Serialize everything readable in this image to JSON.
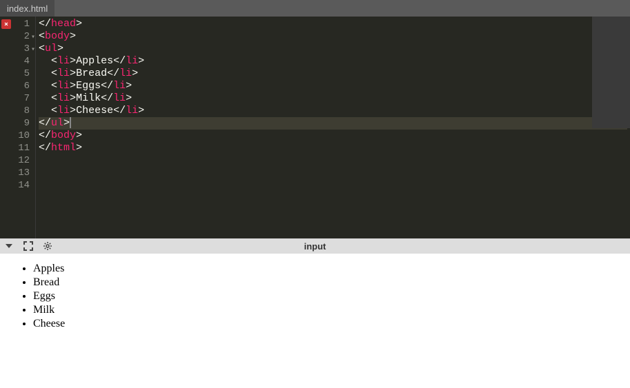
{
  "tab": {
    "filename": "index.html"
  },
  "editor": {
    "lines": [
      {
        "num": "1",
        "hasError": true,
        "hasFold": false,
        "indent": "",
        "tokens": [
          {
            "close": true,
            "name": "head"
          }
        ]
      },
      {
        "num": "2",
        "hasError": false,
        "hasFold": true,
        "indent": "",
        "tokens": [
          {
            "close": false,
            "name": "body"
          }
        ]
      },
      {
        "num": "3",
        "hasError": false,
        "hasFold": true,
        "indent": "",
        "tokens": [
          {
            "close": false,
            "name": "ul"
          }
        ]
      },
      {
        "num": "4",
        "hasError": false,
        "hasFold": false,
        "indent": "  ",
        "tokens": [
          {
            "close": false,
            "name": "li"
          },
          {
            "text": "Apples"
          },
          {
            "close": true,
            "name": "li"
          }
        ]
      },
      {
        "num": "5",
        "hasError": false,
        "hasFold": false,
        "indent": "  ",
        "tokens": [
          {
            "close": false,
            "name": "li"
          },
          {
            "text": "Bread"
          },
          {
            "close": true,
            "name": "li"
          }
        ]
      },
      {
        "num": "6",
        "hasError": false,
        "hasFold": false,
        "indent": "  ",
        "tokens": [
          {
            "close": false,
            "name": "li"
          },
          {
            "text": "Eggs"
          },
          {
            "close": true,
            "name": "li"
          }
        ]
      },
      {
        "num": "7",
        "hasError": false,
        "hasFold": false,
        "indent": "  ",
        "tokens": [
          {
            "close": false,
            "name": "li"
          },
          {
            "text": "Milk"
          },
          {
            "close": true,
            "name": "li"
          }
        ]
      },
      {
        "num": "8",
        "hasError": false,
        "hasFold": false,
        "indent": "  ",
        "tokens": [
          {
            "close": false,
            "name": "li"
          },
          {
            "text": "Cheese"
          },
          {
            "close": true,
            "name": "li"
          }
        ]
      },
      {
        "num": "9",
        "hasError": false,
        "hasFold": false,
        "indent": "",
        "highlighted": true,
        "cursor": true,
        "tokens": [
          {
            "close": true,
            "name": "ul"
          }
        ]
      },
      {
        "num": "10",
        "hasError": false,
        "hasFold": false,
        "indent": "",
        "tokens": [
          {
            "close": true,
            "name": "body"
          }
        ]
      },
      {
        "num": "11",
        "hasError": false,
        "hasFold": false,
        "indent": "",
        "tokens": [
          {
            "close": true,
            "name": "html"
          }
        ]
      },
      {
        "num": "12",
        "hasError": false,
        "hasFold": false,
        "indent": "",
        "tokens": []
      },
      {
        "num": "13",
        "hasError": false,
        "hasFold": false,
        "indent": "",
        "tokens": []
      },
      {
        "num": "14",
        "hasError": false,
        "hasFold": false,
        "indent": "",
        "tokens": []
      }
    ]
  },
  "panel": {
    "title": "input"
  },
  "preview": {
    "items": [
      "Apples",
      "Bread",
      "Eggs",
      "Milk",
      "Cheese"
    ]
  }
}
